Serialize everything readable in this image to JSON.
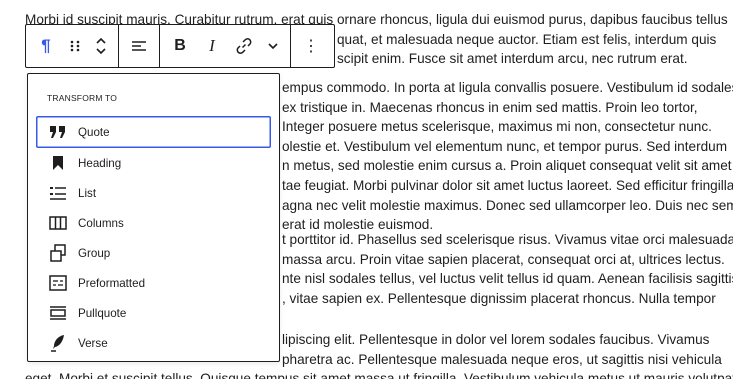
{
  "toolbar": {
    "paragraph_icon": "¶",
    "bold_label": "B",
    "italic_label": "I",
    "more_label": "⋮"
  },
  "transform_menu": {
    "title": "TRANSFORM TO",
    "items": [
      {
        "label": "Quote",
        "icon": "quote-icon",
        "selected": true
      },
      {
        "label": "Heading",
        "icon": "heading-icon"
      },
      {
        "label": "List",
        "icon": "list-icon"
      },
      {
        "label": "Columns",
        "icon": "columns-icon"
      },
      {
        "label": "Group",
        "icon": "group-icon"
      },
      {
        "label": "Preformatted",
        "icon": "preformatted-icon"
      },
      {
        "label": "Pullquote",
        "icon": "pullquote-icon"
      },
      {
        "label": "Verse",
        "icon": "verse-icon"
      }
    ]
  },
  "content": {
    "p1": [
      "Morbi id suscipit mauris. Curabitur rutrum, erat quis ornare rhoncus, ligula dui euismod purus, dapibus faucibus tellus",
      "quat, et malesuada neque auctor. Etiam est felis, interdum quis",
      "scipit enim. Fusce sit amet interdum arcu, nec rutrum erat."
    ],
    "p2": [
      "empus commodo. In porta at ligula convallis posuere. Vestibulum id sodales",
      "ex tristique in. Maecenas rhoncus in enim sed mattis. Proin leo tortor,",
      "Integer posuere metus scelerisque, maximus mi non, consectetur nunc.",
      "olestie et. Vestibulum vel elementum nunc, et tempor purus. Sed interdum",
      "n metus, sed molestie enim cursus a. Proin aliquet consequat velit sit amet",
      "tae feugiat. Morbi pulvinar dolor sit amet luctus laoreet. Sed efficitur fringilla",
      "agna nec velit molestie maximus. Donec sed ullamcorper leo. Duis nec sem",
      "erat id molestie euismod."
    ],
    "p3": [
      "t porttitor id. Phasellus sed scelerisque risus. Vivamus vitae orci malesuada,",
      "massa arcu. Proin vitae sapien placerat, consequat orci at, ultrices lectus.",
      "nte nisl sodales tellus, vel luctus velit tellus id quam. Aenean facilisis sagittis",
      ", vitae sapien ex. Pellentesque dignissim placerat rhoncus. Nulla tempor"
    ],
    "p4": [
      "lipiscing elit. Pellentesque in dolor vel lorem sodales faucibus. Vivamus",
      "pharetra ac. Pellentesque malesuada neque eros, ut sagittis nisi vehicula",
      "eget. Morbi et suscipit tellus. Quisque tempus sit amet massa ut fringilla. Vestibulum vehicula metus ut mauris volutpat,"
    ]
  }
}
